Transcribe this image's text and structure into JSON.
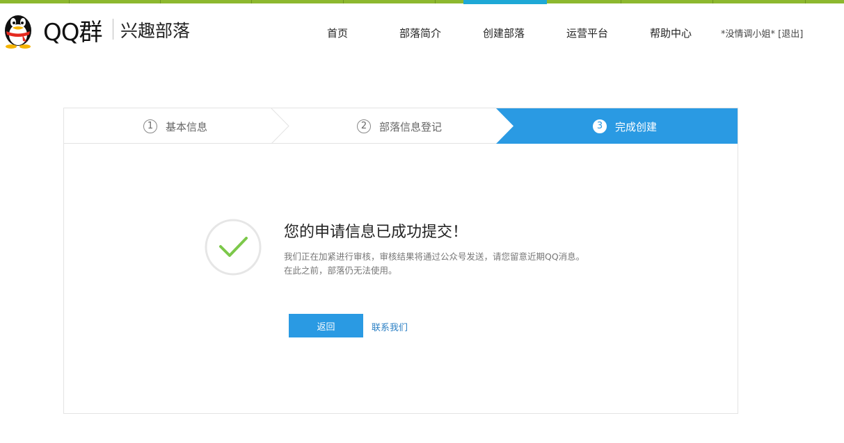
{
  "brand": {
    "name": "QQ群",
    "subtitle": "兴趣部落"
  },
  "nav": {
    "items": [
      {
        "label": "首页"
      },
      {
        "label": "部落简介"
      },
      {
        "label": "创建部落",
        "active": true
      },
      {
        "label": "运营平台"
      },
      {
        "label": "帮助中心"
      }
    ]
  },
  "user": {
    "name": "*没情调小姐*",
    "logout": "[退出]"
  },
  "steps": [
    {
      "num": "1",
      "label": "基本信息"
    },
    {
      "num": "2",
      "label": "部落信息登记"
    },
    {
      "num": "3",
      "label": "完成创建",
      "active": true
    }
  ],
  "result": {
    "title": "您的申请信息已成功提交！",
    "line1": "我们正在加紧进行审核，审核结果将通过公众号发送，请您留意近期QQ消息。",
    "line2": "在此之前，部落仍无法使用。"
  },
  "actions": {
    "back": "返回",
    "contact": "联系我们"
  },
  "colors": {
    "accent": "#2a9ae3",
    "topbar": "#8db82f",
    "success": "#7cc84a"
  },
  "icons": {
    "logo": "qq-penguin-icon",
    "success": "checkmark-icon"
  }
}
